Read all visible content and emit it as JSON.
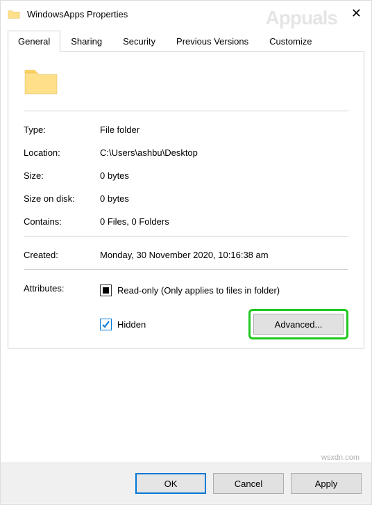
{
  "title": "WindowsApps Properties",
  "tabs": {
    "general": "General",
    "sharing": "Sharing",
    "security": "Security",
    "previous": "Previous Versions",
    "customize": "Customize"
  },
  "labels": {
    "type": "Type:",
    "location": "Location:",
    "size": "Size:",
    "sizeOnDisk": "Size on disk:",
    "contains": "Contains:",
    "created": "Created:",
    "attributes": "Attributes:"
  },
  "values": {
    "type": "File folder",
    "location": "C:\\Users\\ashbu\\Desktop",
    "size": "0 bytes",
    "sizeOnDisk": "0 bytes",
    "contains": "0 Files, 0 Folders",
    "created": "Monday, 30 November 2020, 10:16:38 am"
  },
  "attrib": {
    "readonly": "Read-only (Only applies to files in folder)",
    "hidden": "Hidden",
    "advanced": "Advanced..."
  },
  "buttons": {
    "ok": "OK",
    "cancel": "Cancel",
    "apply": "Apply"
  },
  "watermark": {
    "logo": "Appuals",
    "url": "wsxdn.com"
  }
}
